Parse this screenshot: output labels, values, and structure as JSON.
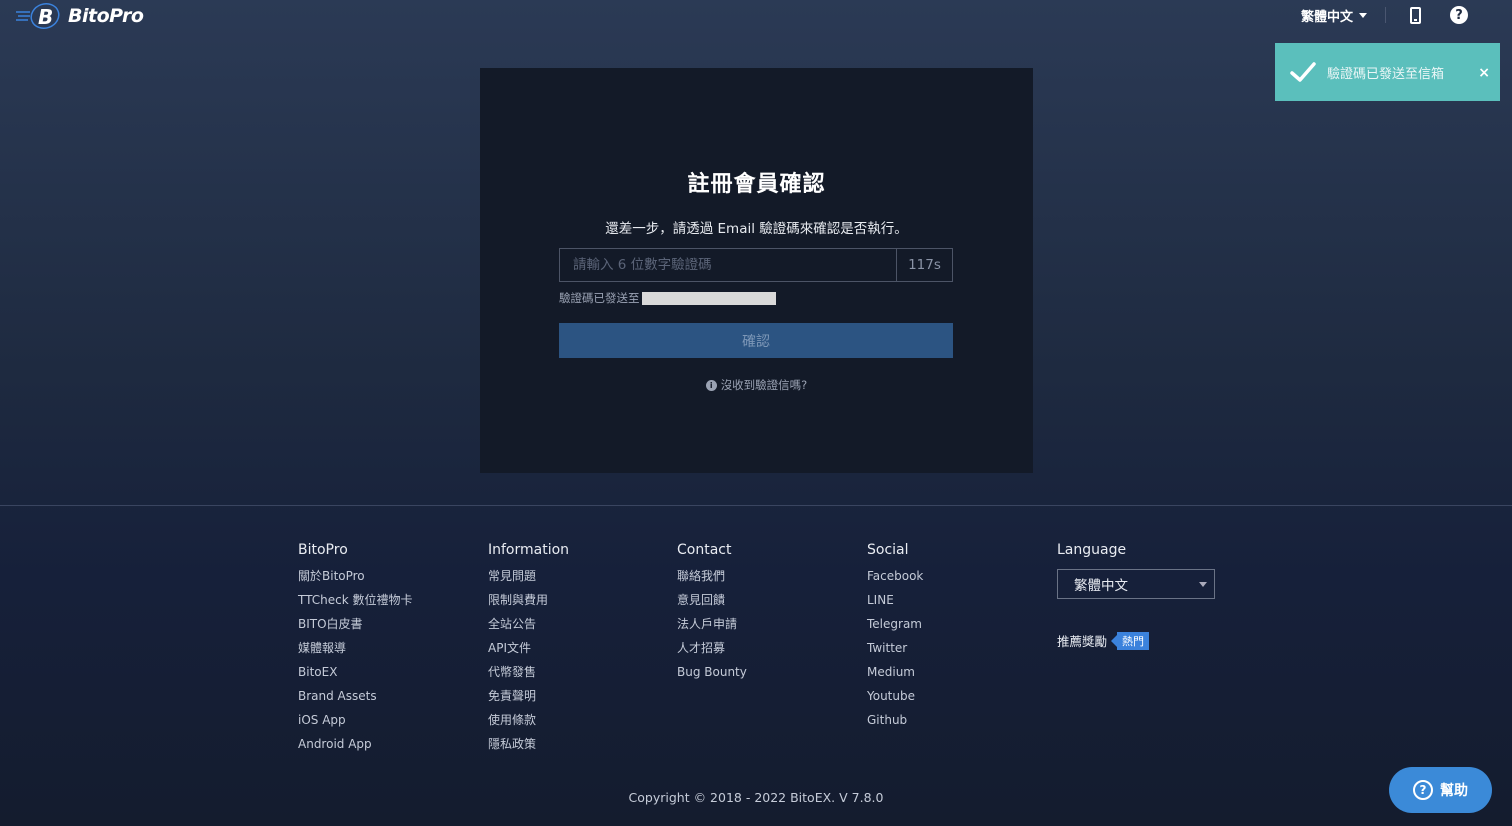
{
  "header": {
    "brand": "BitoPro",
    "language": "繁體中文"
  },
  "toast": {
    "message": "驗證碼已發送至信箱",
    "close": "×"
  },
  "verify": {
    "title": "註冊會員確認",
    "subtitle": "還差一步，請透過 Email 驗證碼來確認是否執行。",
    "placeholder": "請輸入 6 位數字驗證碼",
    "timer": "117s",
    "sent_to": "驗證碼已發送至",
    "confirm": "確認",
    "no_mail": "沒收到驗證信嗎?"
  },
  "footer": {
    "columns": [
      {
        "title": "BitoPro",
        "links": [
          "關於BitoPro",
          "TTCheck 數位禮物卡",
          "BITO白皮書",
          "媒體報導",
          "BitoEX",
          "Brand Assets",
          "iOS App",
          "Android App"
        ]
      },
      {
        "title": "Information",
        "links": [
          "常見問題",
          "限制與費用",
          "全站公告",
          "API文件",
          "代幣發售",
          "免責聲明",
          "使用條款",
          "隱私政策"
        ]
      },
      {
        "title": "Contact",
        "links": [
          "聯絡我們",
          "意見回饋",
          "法人戶申請",
          "人才招募",
          "Bug Bounty"
        ]
      },
      {
        "title": "Social",
        "links": [
          "Facebook",
          "LINE",
          "Telegram",
          "Twitter",
          "Medium",
          "Youtube",
          "Github"
        ]
      }
    ],
    "language_title": "Language",
    "language_value": "繁體中文",
    "referral": "推薦獎勵",
    "hot": "熱門",
    "copyright": "Copyright © 2018 - 2022 BitoEX. V 7.8.0",
    "help": "幫助"
  },
  "colors": {
    "toast": "#5bbfbc",
    "button": "#2c5482",
    "accent": "#3b8ad8"
  }
}
